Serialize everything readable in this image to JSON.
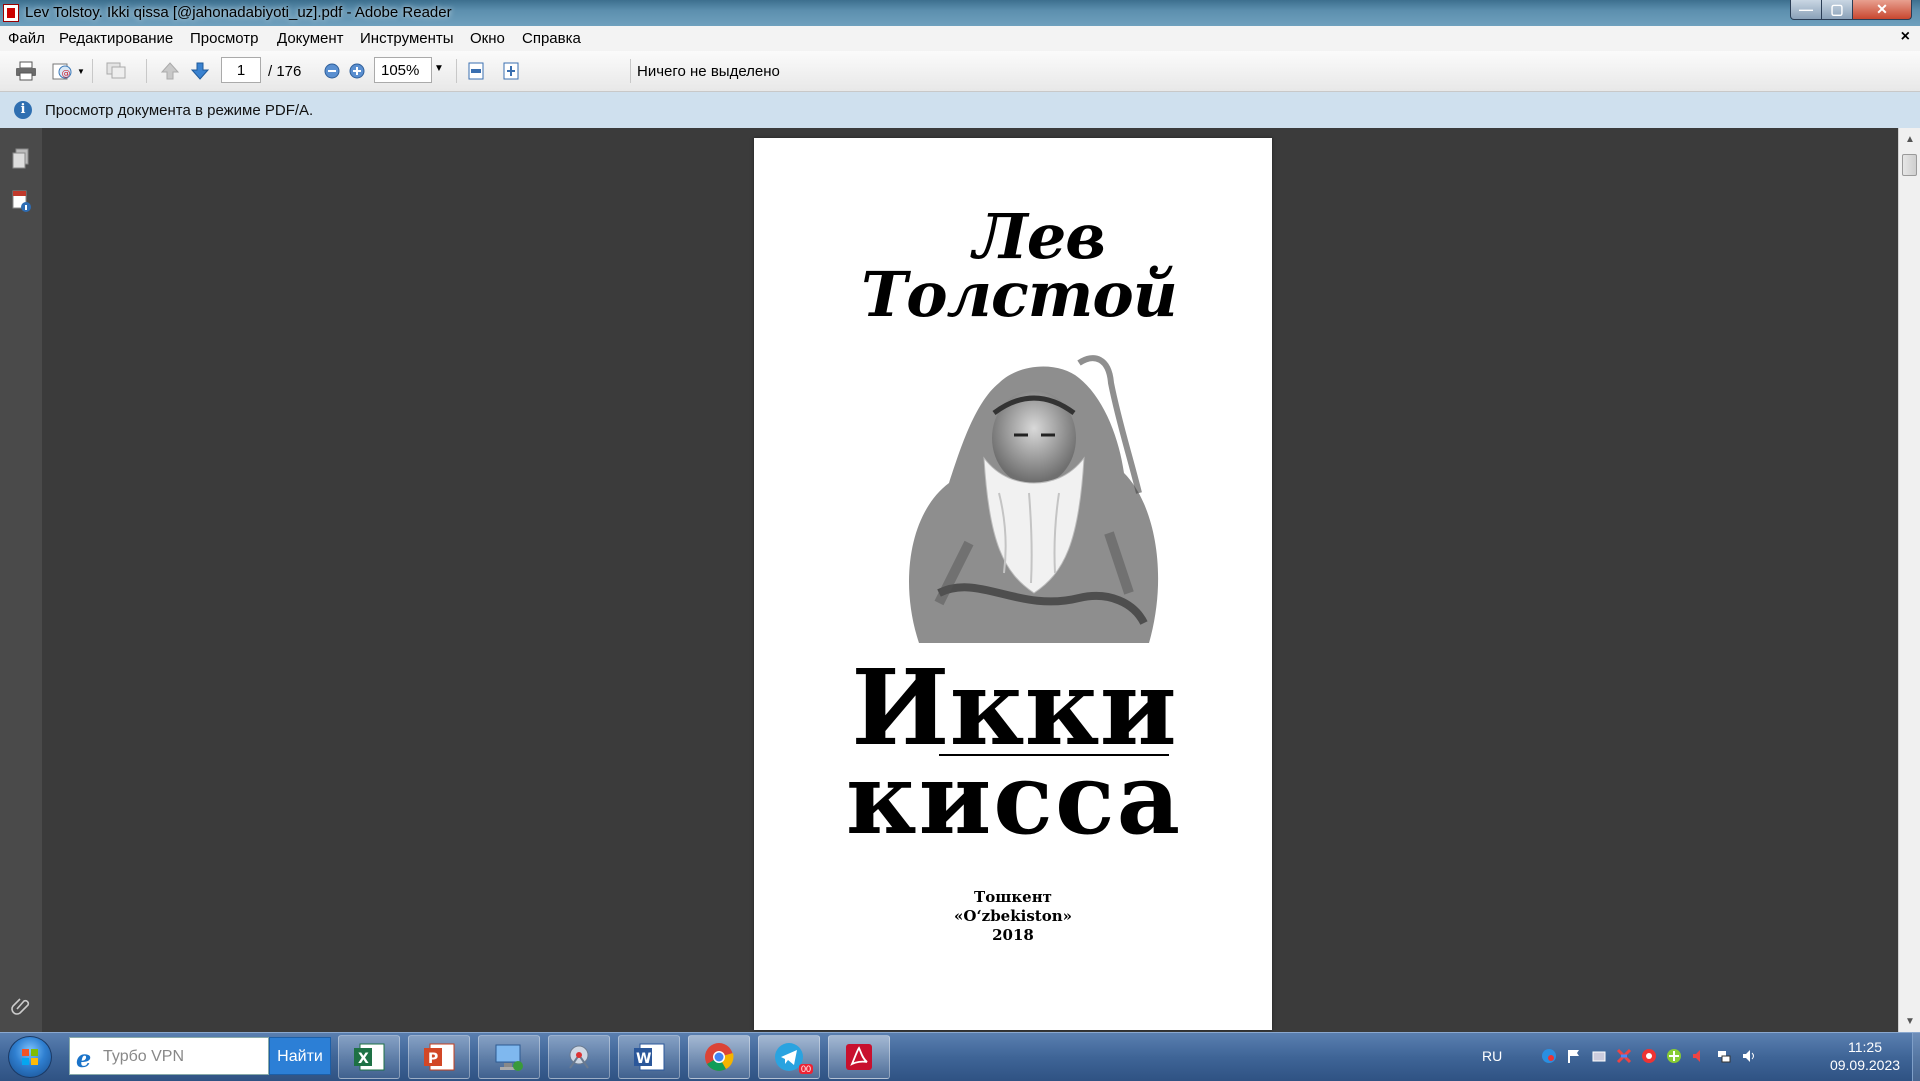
{
  "window": {
    "title": "Lev Tolstoy. Ikki qissa [@jahonadabiyoti_uz].pdf - Adobe Reader",
    "minimize_label": "—",
    "maximize_label": "▢",
    "close_label": "✕"
  },
  "menu": {
    "items": [
      "Файл",
      "Редактирование",
      "Просмотр",
      "Документ",
      "Инструменты",
      "Окно",
      "Справка"
    ],
    "close_label": "×"
  },
  "toolbar": {
    "current_page": "1",
    "total_pages": "/ 176",
    "zoom": "105%",
    "selection_status": "Ничего не выделено"
  },
  "infobar": {
    "icon": "info-icon",
    "text": "Просмотр документа в режиме PDF/A."
  },
  "document": {
    "author_line1": "Лев",
    "author_line2": "Толстой",
    "title_line1": "Икки",
    "title_line2": "кисса",
    "city": "Тошкент",
    "publisher": "«O‘zbekiston»",
    "year": "2018"
  },
  "taskbar": {
    "search_placeholder": "Турбо VPN",
    "search_button": "Найти",
    "apps": [
      "excel-icon",
      "powerpoint-icon",
      "computer-icon",
      "network-icon",
      "word-icon",
      "chrome-icon",
      "telegram-icon",
      "adobe-reader-icon"
    ],
    "telegram_badge": "00",
    "language": "RU",
    "time": "11:25",
    "date": "09.09.2023"
  },
  "colors": {
    "infobar_bg": "#cfe0ee",
    "doc_bg": "#3b3b3b",
    "taskbar": "#3f6597",
    "accent": "#2c7fd6"
  }
}
